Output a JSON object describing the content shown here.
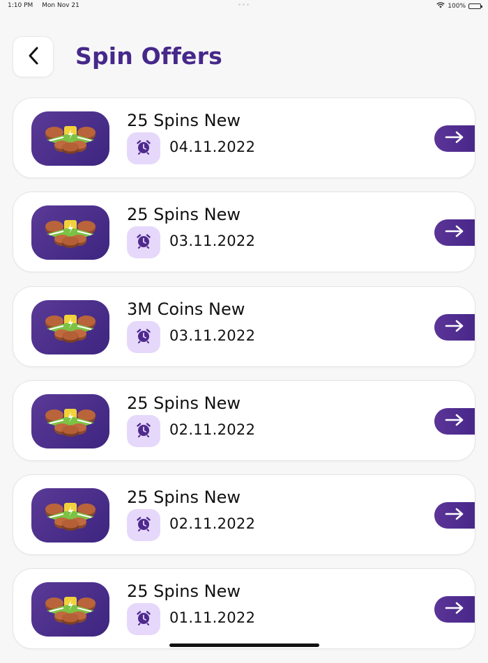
{
  "status_bar": {
    "time": "1:10 PM",
    "date": "Mon Nov 21",
    "battery": "100%",
    "icons": [
      "wifi-icon",
      "battery-icon"
    ]
  },
  "header": {
    "back_icon": "chevron-left-icon",
    "title": "Spin Offers"
  },
  "colors": {
    "accent": "#46288a",
    "button_purple": "#5b3597",
    "badge_lavender": "#e6d8fb",
    "background": "#f7f7f7"
  },
  "offers": [
    {
      "title": "25 Spins New",
      "date": "04.11.2022"
    },
    {
      "title": "25 Spins New",
      "date": "03.11.2022"
    },
    {
      "title": "3M Coins New",
      "date": "03.11.2022"
    },
    {
      "title": "25 Spins New",
      "date": "02.11.2022"
    },
    {
      "title": "25 Spins New",
      "date": "02.11.2022"
    },
    {
      "title": "25 Spins New",
      "date": "01.11.2022"
    }
  ],
  "offer_icons": {
    "thumbnail": "coin-master-spins-icon",
    "clock": "alarm-clock-icon",
    "go": "arrow-right-icon"
  }
}
